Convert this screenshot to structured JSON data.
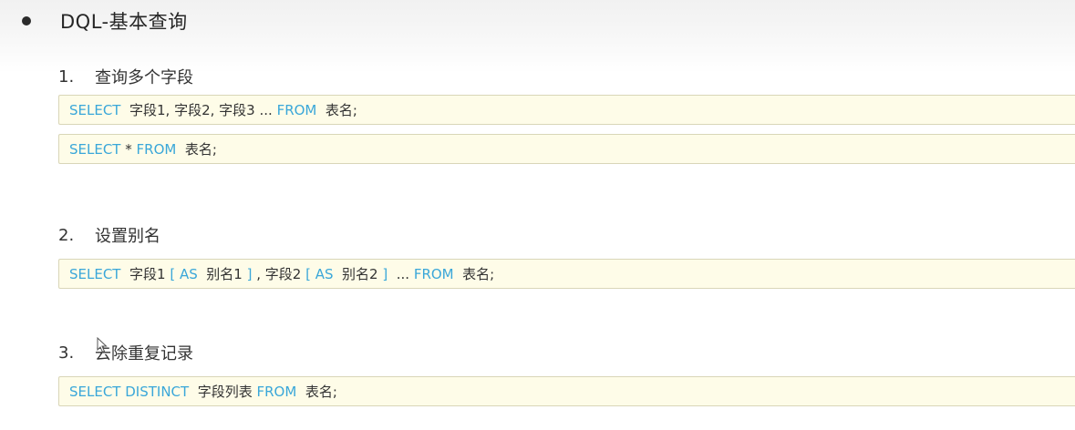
{
  "heading": "DQL-基本查询",
  "sections": [
    {
      "number": "1.",
      "title": "查询多个字段",
      "codes": [
        [
          {
            "kind": "kw",
            "text": "SELECT "
          },
          {
            "kind": "tx",
            "text": " 字段1, 字段2, 字段3 ... "
          },
          {
            "kind": "kw",
            "text": "FROM"
          },
          {
            "kind": "tx",
            "text": "  表名;"
          }
        ],
        [
          {
            "kind": "kw",
            "text": "SELECT"
          },
          {
            "kind": "tx",
            "text": " * "
          },
          {
            "kind": "kw",
            "text": "FROM"
          },
          {
            "kind": "tx",
            "text": "  表名;"
          }
        ]
      ]
    },
    {
      "number": "2.",
      "title": "设置别名",
      "codes": [
        [
          {
            "kind": "kw",
            "text": "SELECT "
          },
          {
            "kind": "tx",
            "text": " 字段1 "
          },
          {
            "kind": "kw",
            "text": "[ AS "
          },
          {
            "kind": "tx",
            "text": " 别名1 "
          },
          {
            "kind": "kw",
            "text": "]"
          },
          {
            "kind": "tx",
            "text": " , 字段2 "
          },
          {
            "kind": "kw",
            "text": "[ AS "
          },
          {
            "kind": "tx",
            "text": " 别名2 "
          },
          {
            "kind": "kw",
            "text": "]"
          },
          {
            "kind": "tx",
            "text": "  ... "
          },
          {
            "kind": "kw",
            "text": "FROM"
          },
          {
            "kind": "tx",
            "text": "  表名;"
          }
        ]
      ]
    },
    {
      "number": "3.",
      "title": "去除重复记录",
      "codes": [
        [
          {
            "kind": "kw",
            "text": "SELECT DISTINCT "
          },
          {
            "kind": "tx",
            "text": " 字段列表 "
          },
          {
            "kind": "kw",
            "text": "FROM"
          },
          {
            "kind": "tx",
            "text": "  表名;"
          }
        ]
      ]
    }
  ]
}
